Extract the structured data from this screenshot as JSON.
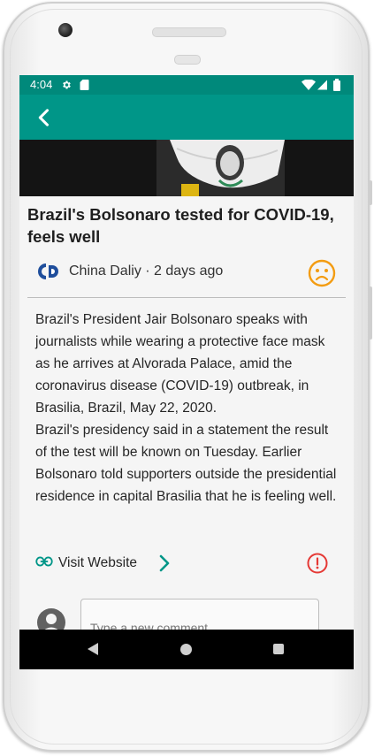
{
  "status_bar": {
    "time": "4:04"
  },
  "article": {
    "headline": "Brazil's Bolsonaro tested for COVID-19, feels well",
    "source_line": "China Daliy · 2 days ago",
    "body": "Brazil's President Jair Bolsonaro speaks with journalists while wearing a protective face mask as he arrives at Alvorada Palace, amid the coronavirus disease (COVID-19) outbreak, in Brasilia, Brazil, May 22, 2020.\nBrazil's presidency said in a statement the result of the test will be known on Tuesday. Earlier Bolsonaro told supporters outside the presidential residence in capital Brasilia that he is feeling well.",
    "visit_label": "Visit Website"
  },
  "comment": {
    "placeholder": "Type a new comment..."
  },
  "colors": {
    "teal": "#009688",
    "status_teal": "#00897b",
    "sentiment_orange": "#f39c12",
    "alert_red": "#e53935"
  },
  "icons": [
    "back-arrow-icon",
    "settings-icon",
    "sd-card-icon",
    "wifi-icon",
    "signal-icon",
    "battery-icon",
    "sad-face-icon",
    "link-icon",
    "chevron-right-icon",
    "report-icon",
    "avatar-icon",
    "nav-back-icon",
    "nav-home-icon",
    "nav-recents-icon"
  ]
}
